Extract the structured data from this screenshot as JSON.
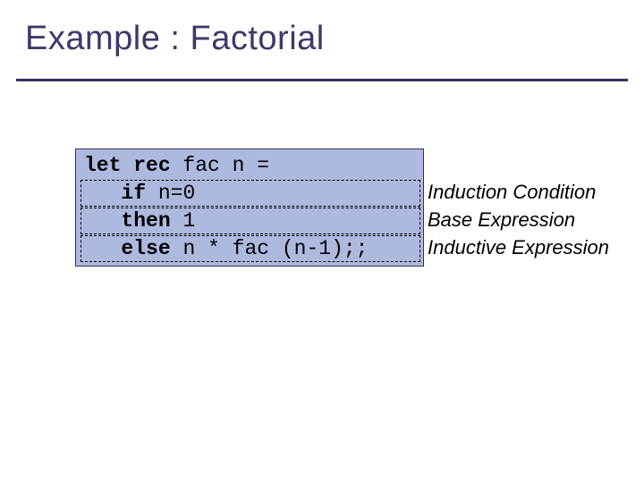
{
  "title": "Example : Factorial",
  "code": {
    "line1": {
      "kw": "let rec",
      "rest": " fac n ="
    },
    "line2": {
      "kw": "if",
      "rest": " n=0"
    },
    "line3": {
      "kw": "then",
      "rest": " 1"
    },
    "line4": {
      "kw": "else",
      "rest": " n * fac (n-1);;"
    },
    "indent": "   "
  },
  "annotations": {
    "a1": "Induction Condition",
    "a2": "Base Expression",
    "a3": "Inductive Expression"
  }
}
